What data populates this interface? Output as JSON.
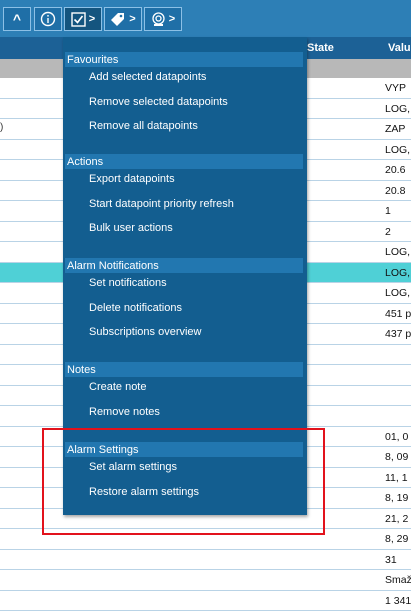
{
  "toolbar": {
    "buttons": [
      {
        "icon": "chevron-up-icon",
        "glyph": "^"
      },
      {
        "icon": "info-icon",
        "glyph": "ⓘ"
      },
      {
        "icon": "checkbox-icon",
        "chev": ">"
      },
      {
        "icon": "tag-icon",
        "chev": ">"
      },
      {
        "icon": "bell-icon",
        "chev": ">"
      }
    ]
  },
  "table": {
    "header": {
      "state": "State",
      "value": "Valu"
    },
    "left_text": ")",
    "values": [
      "VYP",
      "LOG,",
      "ZAP",
      "LOG,",
      "20.6",
      "20.8",
      "1",
      "2",
      "LOG,",
      "LOG,",
      "LOG,",
      "451 p",
      "437 p",
      "",
      "",
      "",
      "",
      "01, 0",
      "8, 09",
      "11, 1",
      "8, 19",
      "21, 2",
      "8, 29",
      "31",
      "Smaž",
      "1 341"
    ],
    "highlighted_row": 9
  },
  "menu": {
    "sections": [
      {
        "title": "Favourites",
        "items": [
          "Add selected datapoints",
          "Remove selected datapoints",
          "Remove all datapoints"
        ]
      },
      {
        "title": "Actions",
        "items": [
          "Export datapoints",
          "Start datapoint priority refresh",
          "Bulk user actions"
        ]
      },
      {
        "title": "Alarm Notifications",
        "items": [
          "Set notifications",
          "Delete notifications",
          "Subscriptions overview"
        ]
      },
      {
        "title": "Notes",
        "items": [
          "Create note",
          "Remove notes"
        ]
      },
      {
        "title": "Alarm Settings",
        "items": [
          "Set alarm settings",
          "Restore alarm settings"
        ]
      }
    ]
  },
  "colors": {
    "toolbar": "#2d7fb6",
    "menu": "#135e90",
    "section_header": "#2277b0",
    "highlight_row": "#4fd0d6",
    "annotation": "#e2121c"
  }
}
